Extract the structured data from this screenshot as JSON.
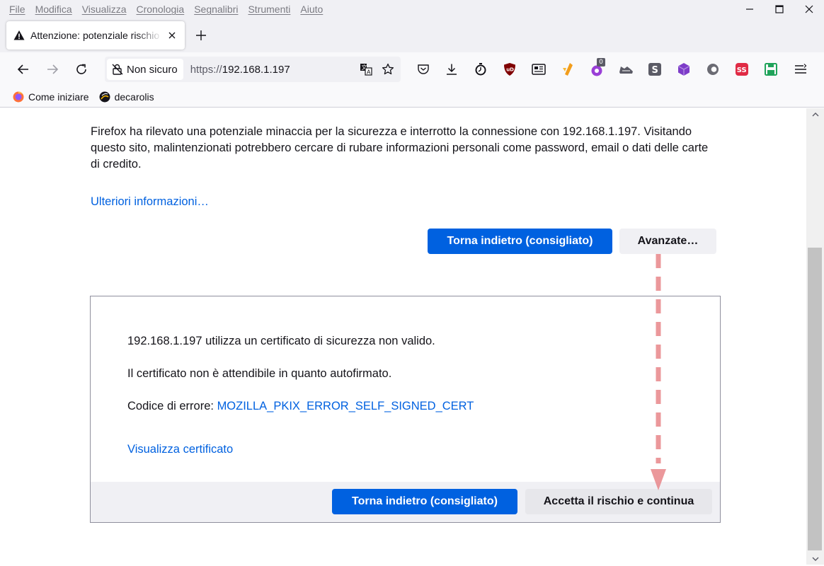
{
  "menubar": {
    "items": [
      "File",
      "Modifica",
      "Visualizza",
      "Cronologia",
      "Segnalibri",
      "Strumenti",
      "Aiuto"
    ]
  },
  "tab": {
    "title": "Attenzione: potenziale rischio per la sicurezza"
  },
  "urlbar": {
    "identity_label": "Non sicuro",
    "url_scheme": "https://",
    "url_host": "192.168.1.197",
    "extension_badge": "0"
  },
  "bookmarks": [
    {
      "label": "Come iniziare"
    },
    {
      "label": "decarolis"
    }
  ],
  "page": {
    "description": "Firefox ha rilevato una potenziale minaccia per la sicurezza e interrotto la connessione con 192.168.1.197. Visitando questo sito, malintenzionati potrebbero cercare di rubare informazioni personali come password, email o dati delle carte di credito.",
    "learn_more": "Ulteriori informazioni…",
    "go_back_label": "Torna indietro (consigliato)",
    "advanced_label": "Avanzate…"
  },
  "advanced": {
    "line1": "192.168.1.197 utilizza un certificato di sicurezza non valido.",
    "line2": "Il certificato non è attendibile in quanto autofirmato.",
    "error_code_label": "Codice di errore: ",
    "error_code": "MOZILLA_PKIX_ERROR_SELF_SIGNED_CERT",
    "view_certificate": "Visualizza certificato",
    "go_back_label": "Torna indietro (consigliato)",
    "accept_label": "Accetta il rischio e continua"
  },
  "colors": {
    "accent": "#0061e0",
    "annotation_arrow": "#e8868a"
  }
}
